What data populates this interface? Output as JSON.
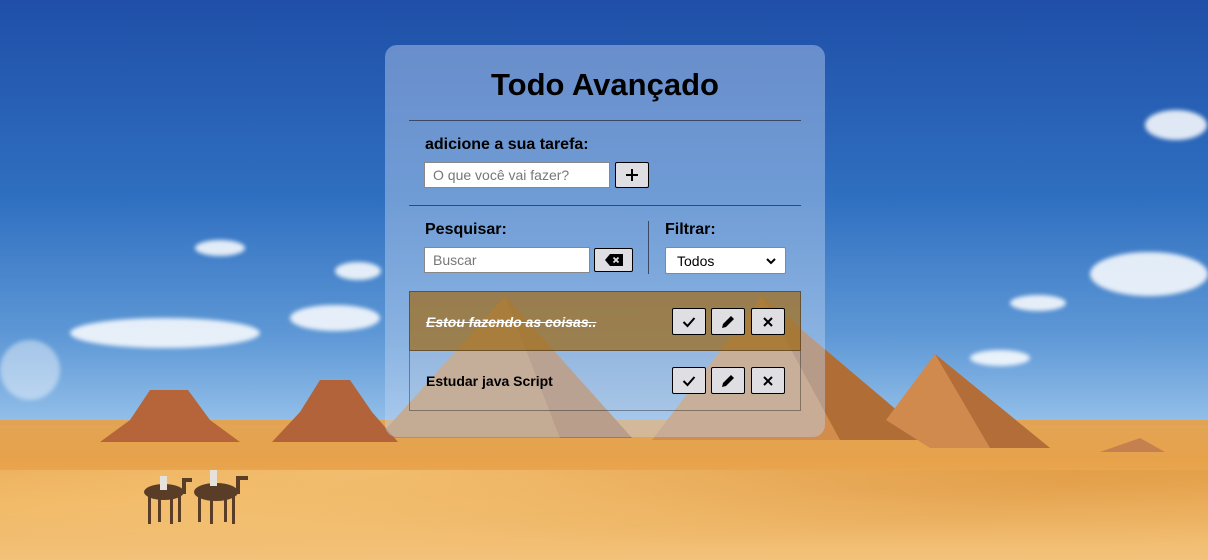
{
  "app": {
    "title": "Todo Avançado"
  },
  "add_section": {
    "label": "adicione a sua tarefa:",
    "input_placeholder": "O que você vai fazer?",
    "input_value": "",
    "add_icon": "plus-icon"
  },
  "search_section": {
    "label": "Pesquisar:",
    "input_placeholder": "Buscar",
    "input_value": "",
    "clear_icon": "backspace-icon"
  },
  "filter_section": {
    "label": "Filtrar:",
    "selected": "Todos"
  },
  "todos": [
    {
      "text": "Estou fazendo as coisas..",
      "done": true
    },
    {
      "text": "Estudar java Script",
      "done": false
    }
  ],
  "todo_actions": [
    "check-icon",
    "pencil-icon",
    "x-icon"
  ],
  "colors": {
    "done_background": "#a06e1e",
    "card_background": "#bed2f0"
  }
}
